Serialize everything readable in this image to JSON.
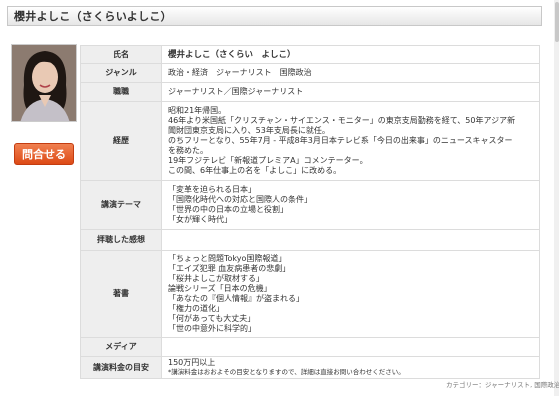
{
  "header": {
    "title": "櫻井よしこ（さくらいよしこ）"
  },
  "contact_button": {
    "label": "問合せる"
  },
  "profile": {
    "name": {
      "label": "氏名",
      "value": "櫻井よしこ（さくらい　よしこ）"
    },
    "genre": {
      "label": "ジャンル",
      "value": "政治・経済　ジャーナリスト　国際政治"
    },
    "title": {
      "label": "職職",
      "value": "ジャーナリスト／国際ジャーナリスト"
    },
    "career": {
      "label": "経歴",
      "lines": [
        "昭和21年帰国。",
        "46年より米国紙「クリスチャン・サイエンス・モニター」の東京支局勤務を経て、50年アジア新",
        "聞財団東京支局に入り、53年支局長に就任。",
        "のちフリーとなり、55年7月 - 平成8年3月日本テレビ系「今日の出来事」のニュースキャスター",
        "を務めた。",
        "19年フジテレビ「新報道プレミアA」コメンテーター。",
        "この間、6年仕事上の名を「よしこ」に改める。"
      ]
    },
    "themes": {
      "label": "講演テーマ",
      "lines": [
        "「変革を迫られる日本」",
        "「国際化時代への対応と国際人の条件」",
        "「世界の中の日本の立場と役割」",
        "「女が輝く時代」"
      ]
    },
    "impressions": {
      "label": "拝聴した感想",
      "value": ""
    },
    "works": {
      "label": "著書",
      "lines": [
        "「ちょっと問題Tokyo国際報道」",
        "「エイズ犯罪 血友病患者の悲劇」",
        "「桜井よしこが取材する」",
        "論戦シリーズ「日本の危機」",
        "「あなたの『個人情報』が盗まれる」",
        "「権力の道化」",
        "「何があっても大丈夫」",
        "「世の中意外に科学的」"
      ]
    },
    "media": {
      "label": "メディア",
      "value": ""
    },
    "fee": {
      "label": "講演料金の目安",
      "value": "150万円以上",
      "note": "*講演料金はおおよその目安となりますので、詳細は直接お問い合わせください。"
    }
  },
  "footer": {
    "category": "カテゴリー：ジャーナリスト, 国際政治"
  }
}
